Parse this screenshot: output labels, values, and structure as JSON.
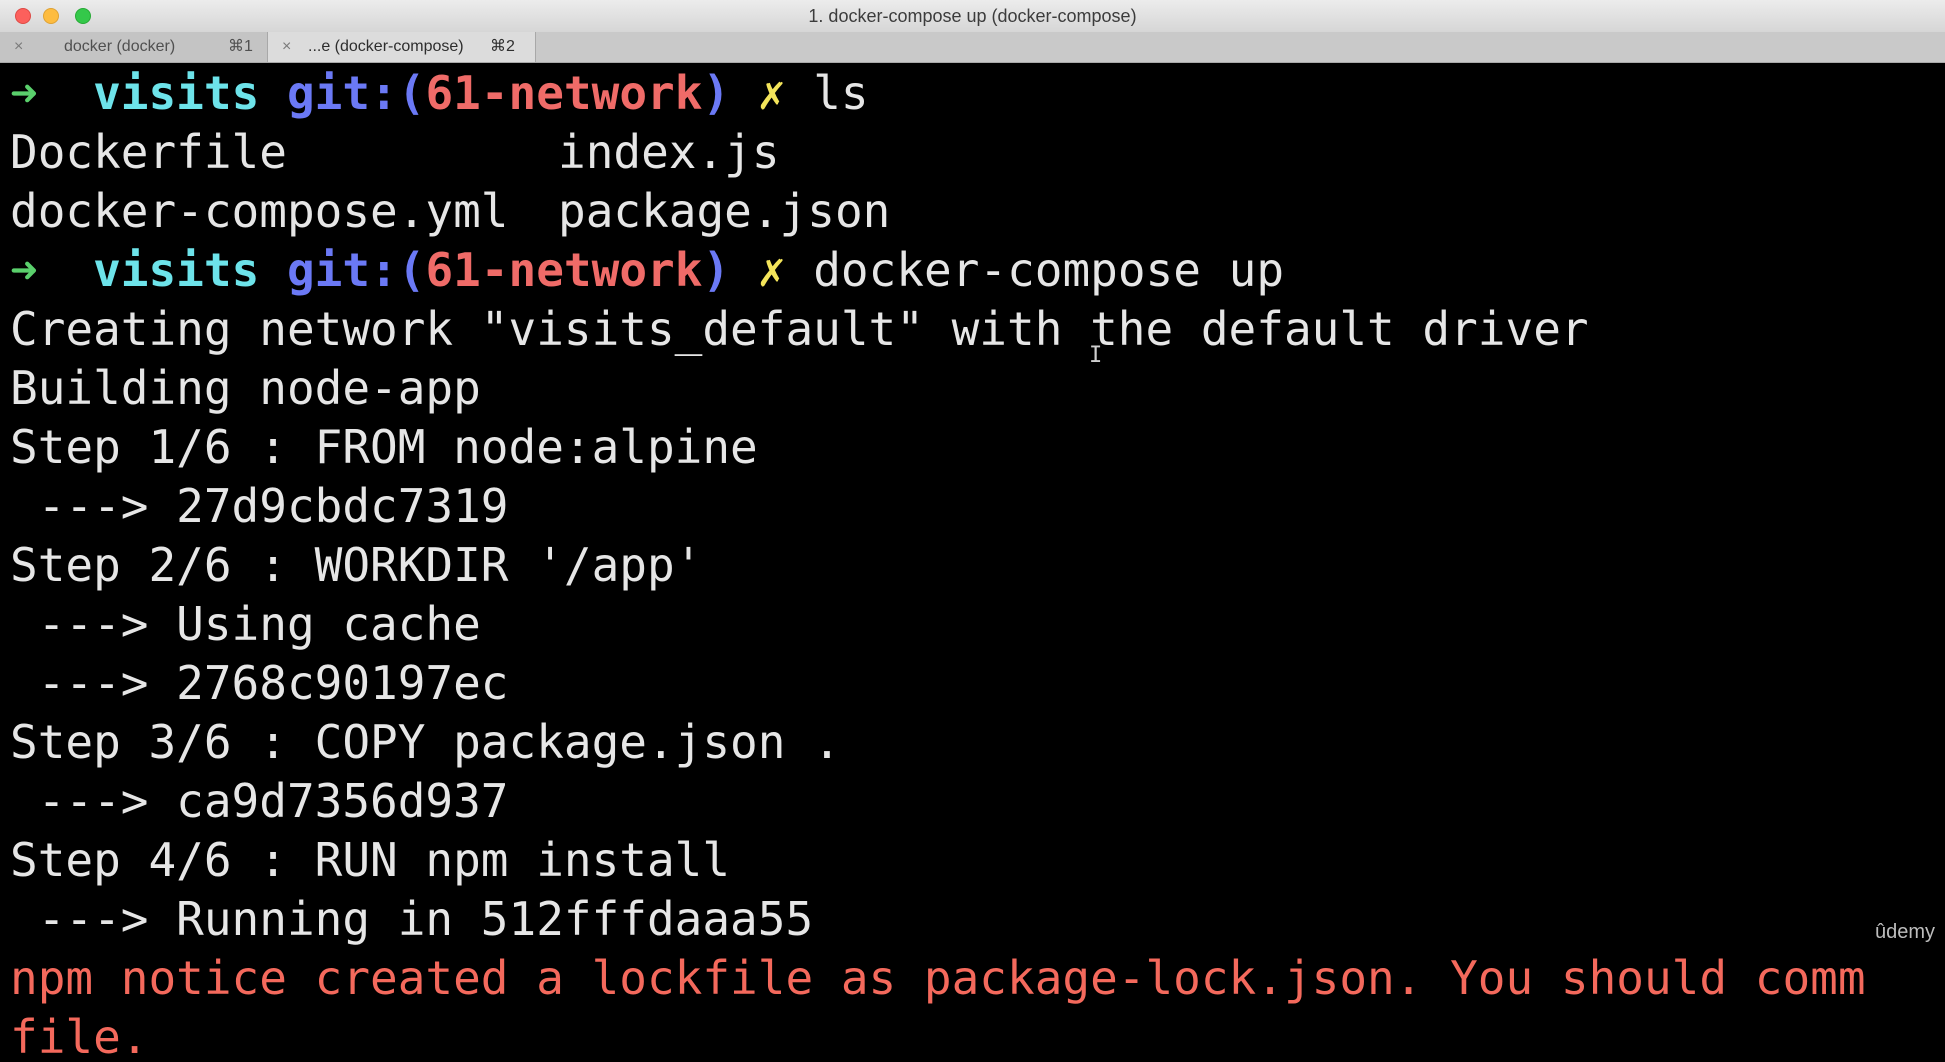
{
  "window": {
    "title": "1. docker-compose up (docker-compose)"
  },
  "tabs": [
    {
      "label": "docker (docker)",
      "shortcut": "⌘1",
      "close_icon": "×",
      "active": false
    },
    {
      "label": "...e (docker-compose)",
      "shortcut": "⌘2",
      "close_icon": "×",
      "active": true
    }
  ],
  "prompt": {
    "arrow": "➜",
    "dir": "visits",
    "git_prefix": "git:(",
    "branch": "61-network",
    "git_suffix": ")",
    "dirty_mark": "✗"
  },
  "terminal": {
    "cmd1": "ls",
    "ls_row1_col1": "Dockerfile",
    "ls_row1_col2": "index.js",
    "ls_row2_col1": "docker-compose.yml",
    "ls_row2_col2": "package.json",
    "cmd2": "docker-compose up",
    "output": [
      "Creating network \"visits_default\" with the default driver",
      "Building node-app",
      "Step 1/6 : FROM node:alpine",
      " ---> 27d9cbdc7319",
      "Step 2/6 : WORKDIR '/app'",
      " ---> Using cache",
      " ---> 2768c90197ec",
      "Step 3/6 : COPY package.json .",
      " ---> ca9d7356d937",
      "Step 4/6 : RUN npm install",
      " ---> Running in 512fffdaaa55"
    ],
    "error_lines": [
      "npm notice created a lockfile as package-lock.json. You should comm",
      "file."
    ]
  },
  "watermark": "ûdemy",
  "colors": {
    "background": "#000000",
    "text": "#e6e6e6",
    "prompt_arrow": "#5ad06c",
    "prompt_dir": "#6de3ea",
    "prompt_git": "#6b79f5",
    "prompt_branch": "#ef6b68",
    "prompt_dirty": "#f3e45a",
    "error_text": "#f4695c"
  }
}
